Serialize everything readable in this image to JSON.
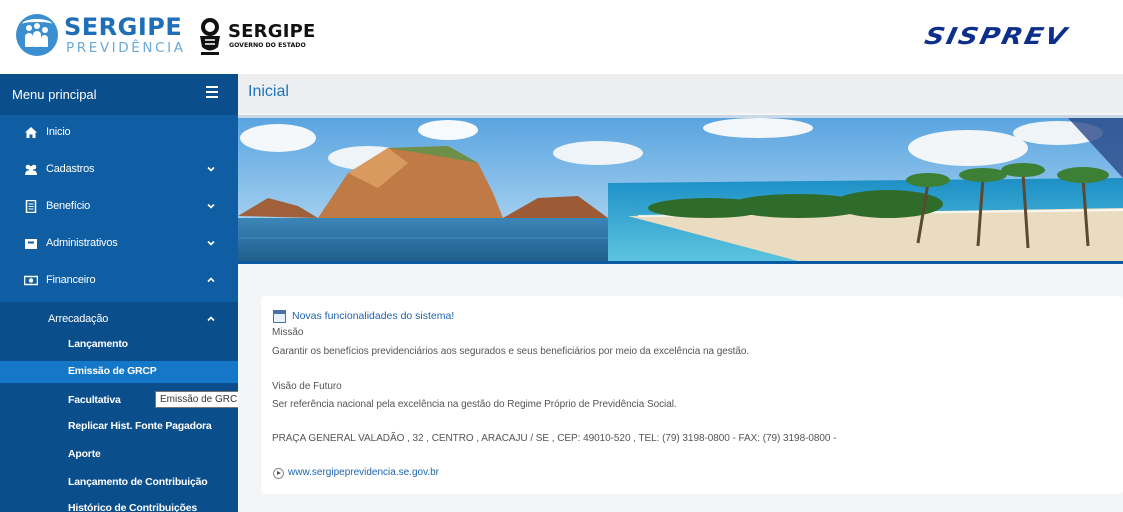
{
  "header": {
    "logo_sergipe_prev": {
      "line1": "SERGIPE",
      "line2": "PREVIDÊNCIA"
    },
    "logo_governo": {
      "line1": "SERGIPE",
      "line2": "GOVERNO DO ESTADO"
    },
    "logo_sisprev": "SISPREV"
  },
  "sidebar": {
    "title": "Menu principal",
    "items": [
      {
        "label": "Inicio",
        "icon": "home-icon"
      },
      {
        "label": "Cadastros",
        "icon": "users-icon"
      },
      {
        "label": "Benefício",
        "icon": "document-icon"
      },
      {
        "label": "Administrativos",
        "icon": "folder-icon"
      },
      {
        "label": "Financeiro",
        "icon": "money-icon"
      }
    ],
    "submenu": {
      "label": "Arrecadação",
      "items": [
        "Lançamento",
        "Emissão de GRCP",
        "Facultativa",
        "Replicar Hist. Fonte Pagadora",
        "Aporte",
        "Lançamento de Contribuição",
        "Histórico de Contribuições"
      ],
      "active_index": 1
    },
    "tooltip": "Emissão de GRCP"
  },
  "main": {
    "page_title": "Inicial",
    "news_link": "Novas funcionalidades do sistema!",
    "mission_title": "Missão",
    "mission_text": "Garantir os benefícios previdenciários aos segurados e seus beneficiários por meio da excelência na gestão.",
    "vision_title": "Visão de Futuro",
    "vision_text": "Ser referência nacional pela excelência na gestão do Regime Próprio de Previdência Social.",
    "address": "PRAÇA GENERAL VALADÃO , 32 , CENTRO , ARACAJU / SE , CEP: 49010-520 , TEL: (79) 3198-0800 - FAX: (79) 3198-0800 -",
    "website": "www.sergipeprevidencia.se.gov.br"
  },
  "colors": {
    "sidebar": "#0f5ea3",
    "sidebar_dark": "#0a4e8c",
    "active_item": "#1577c7",
    "title_blue": "#1d74b8",
    "brand_navy": "#0d2e8a"
  }
}
